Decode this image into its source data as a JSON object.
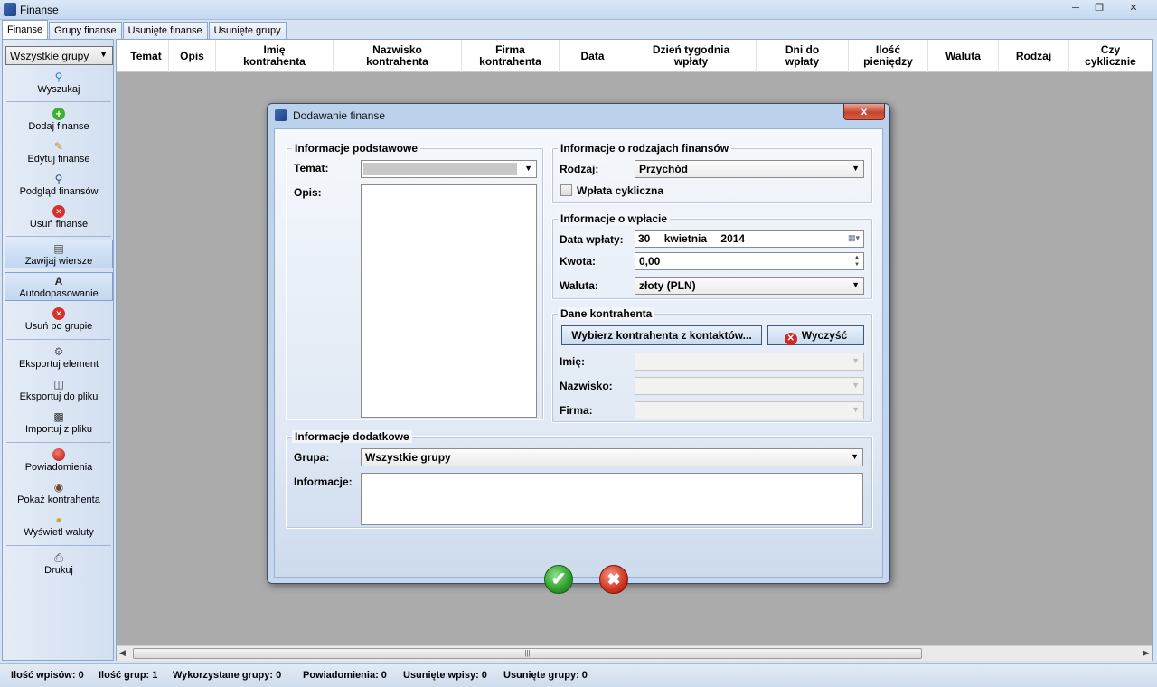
{
  "window": {
    "title": "Finanse",
    "min_icon": "minimize-icon",
    "max_icon": "maximize-icon",
    "close_icon": "close-icon"
  },
  "tabs": [
    {
      "label": "Finanse"
    },
    {
      "label": "Grupy finanse"
    },
    {
      "label": "Usunięte finanse"
    },
    {
      "label": "Usunięte grupy"
    }
  ],
  "sidebar": {
    "group_select": "Wszystkie grupy",
    "items": [
      {
        "label": "Wyszukaj",
        "icon": "search-icon"
      },
      {
        "label": "Dodaj finanse",
        "icon": "add-icon"
      },
      {
        "label": "Edytuj finanse",
        "icon": "pencil-icon"
      },
      {
        "label": "Podgląd finansów",
        "icon": "magnifier-icon"
      },
      {
        "label": "Usuń finanse",
        "icon": "delete-icon"
      },
      {
        "label": "Zawijaj wiersze",
        "icon": "wrap-icon"
      },
      {
        "label": "Autodopasowanie",
        "icon": "autofit-icon"
      },
      {
        "label": "Usuń po grupie",
        "icon": "delete-icon"
      },
      {
        "label": "Eksportuj element",
        "icon": "export-icon"
      },
      {
        "label": "Eksportuj do pliku",
        "icon": "save-icon"
      },
      {
        "label": "Importuj z pliku",
        "icon": "import-icon"
      },
      {
        "label": "Powiadomienia",
        "icon": "notification-icon"
      },
      {
        "label": "Pokaż kontrahenta",
        "icon": "eye-icon"
      },
      {
        "label": "Wyświetl waluty",
        "icon": "coins-icon"
      },
      {
        "label": "Drukuj",
        "icon": "printer-icon"
      }
    ]
  },
  "grid": {
    "columns": [
      "Temat",
      "Opis",
      "Imię\nkontrahenta",
      "Nazwisko\nkontrahenta",
      "Firma\nkontrahenta",
      "Data",
      "Dzień tygodnia\nwpłaty",
      "Dni do\nwpłaty",
      "Ilość\npieniędzy",
      "Waluta",
      "Rodzaj",
      "Czy\ncyklicznie"
    ]
  },
  "statusbar": [
    "Ilość wpisów: 0",
    "Ilość grup: 1",
    "Wykorzystane grupy: 0",
    "Powiadomienia: 0",
    "Usunięte wpisy: 0",
    "Usunięte grupy: 0"
  ],
  "dialog": {
    "title": "Dodawanie finanse",
    "close_label": "x",
    "basic": {
      "title": "Informacje podstawowe",
      "temat_label": "Temat:",
      "opis_label": "Opis:"
    },
    "types": {
      "title": "Informacje o rodzajach finansów",
      "rodzaj_label": "Rodzaj:",
      "rodzaj_value": "Przychód",
      "cyclic_label": "Wpłata cykliczna"
    },
    "payment": {
      "title": "Informacje o wpłacie",
      "date_label": "Data wpłaty:",
      "date_day": "30",
      "date_month": "kwietnia",
      "date_year": "2014",
      "amount_label": "Kwota:",
      "amount_value": "0,00",
      "currency_label": "Waluta:",
      "currency_value": "złoty (PLN)"
    },
    "contractor": {
      "title": "Dane kontrahenta",
      "select_button": "Wybierz kontrahenta z kontaktów...",
      "clear_button": "Wyczyść",
      "first_name_label": "Imię:",
      "last_name_label": "Nazwisko:",
      "company_label": "Firma:"
    },
    "extra": {
      "title": "Informacje dodatkowe",
      "group_label": "Grupa:",
      "group_value": "Wszystkie grupy",
      "info_label": "Informacje:"
    }
  }
}
